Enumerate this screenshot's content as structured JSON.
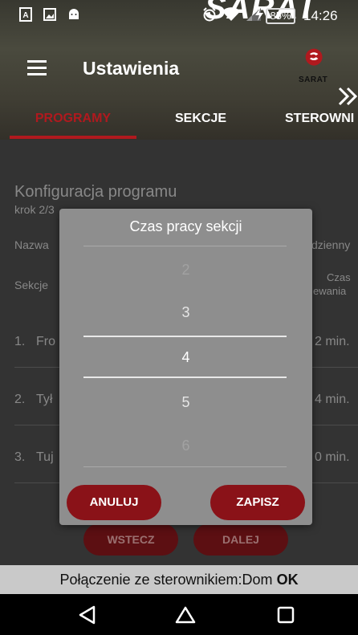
{
  "statusbar": {
    "battery": "85%",
    "time": "14:26"
  },
  "header": {
    "brand_banner": "SARAT",
    "title": "Ustawienia",
    "logo_text": "SARAT"
  },
  "tabs": [
    {
      "label": "PROGRAMY",
      "active": true
    },
    {
      "label": "SEKCJE",
      "active": false
    },
    {
      "label": "STEROWNI",
      "active": false
    }
  ],
  "background": {
    "heading": "Konfiguracja programu",
    "step": "krok 2/3",
    "name_label": "Nazwa",
    "daily_label": "dzienny",
    "sections_label": "Sekcje",
    "time_label_1": "Czas",
    "time_label_2": "ewania",
    "rows": [
      {
        "num": "1.",
        "name": "Fro",
        "time": "2 min."
      },
      {
        "num": "2.",
        "name": "Tył",
        "time": "4 min."
      },
      {
        "num": "3.",
        "name": "Tuj",
        "time": "0 min."
      }
    ],
    "back_button": "WSTECZ",
    "next_button": "DALEJ"
  },
  "dialog": {
    "title": "Czas pracy sekcji",
    "values": [
      "2",
      "3",
      "4",
      "5",
      "6"
    ],
    "selected": "4",
    "cancel": "ANULUJ",
    "save": "ZAPISZ"
  },
  "connection": {
    "prefix": "Połączenie ze sterownikiem:Dom",
    "status": "OK"
  },
  "colors": {
    "accent": "#b0191e",
    "button": "#8a1218"
  }
}
